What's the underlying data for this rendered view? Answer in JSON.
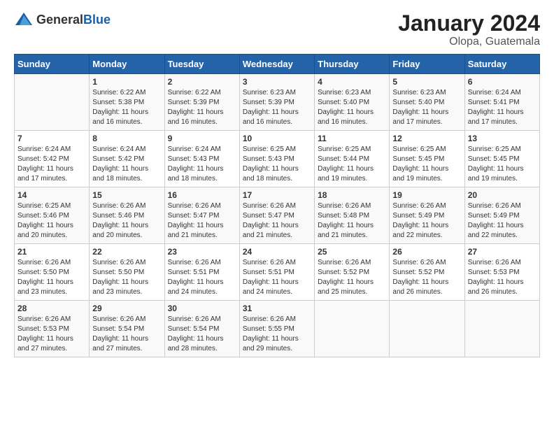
{
  "header": {
    "logo_general": "General",
    "logo_blue": "Blue",
    "title": "January 2024",
    "subtitle": "Olopa, Guatemala"
  },
  "days_of_week": [
    "Sunday",
    "Monday",
    "Tuesday",
    "Wednesday",
    "Thursday",
    "Friday",
    "Saturday"
  ],
  "weeks": [
    [
      {
        "day": "",
        "info": ""
      },
      {
        "day": "1",
        "info": "Sunrise: 6:22 AM\nSunset: 5:38 PM\nDaylight: 11 hours\nand 16 minutes."
      },
      {
        "day": "2",
        "info": "Sunrise: 6:22 AM\nSunset: 5:39 PM\nDaylight: 11 hours\nand 16 minutes."
      },
      {
        "day": "3",
        "info": "Sunrise: 6:23 AM\nSunset: 5:39 PM\nDaylight: 11 hours\nand 16 minutes."
      },
      {
        "day": "4",
        "info": "Sunrise: 6:23 AM\nSunset: 5:40 PM\nDaylight: 11 hours\nand 16 minutes."
      },
      {
        "day": "5",
        "info": "Sunrise: 6:23 AM\nSunset: 5:40 PM\nDaylight: 11 hours\nand 17 minutes."
      },
      {
        "day": "6",
        "info": "Sunrise: 6:24 AM\nSunset: 5:41 PM\nDaylight: 11 hours\nand 17 minutes."
      }
    ],
    [
      {
        "day": "7",
        "info": "Sunrise: 6:24 AM\nSunset: 5:42 PM\nDaylight: 11 hours\nand 17 minutes."
      },
      {
        "day": "8",
        "info": "Sunrise: 6:24 AM\nSunset: 5:42 PM\nDaylight: 11 hours\nand 18 minutes."
      },
      {
        "day": "9",
        "info": "Sunrise: 6:24 AM\nSunset: 5:43 PM\nDaylight: 11 hours\nand 18 minutes."
      },
      {
        "day": "10",
        "info": "Sunrise: 6:25 AM\nSunset: 5:43 PM\nDaylight: 11 hours\nand 18 minutes."
      },
      {
        "day": "11",
        "info": "Sunrise: 6:25 AM\nSunset: 5:44 PM\nDaylight: 11 hours\nand 19 minutes."
      },
      {
        "day": "12",
        "info": "Sunrise: 6:25 AM\nSunset: 5:45 PM\nDaylight: 11 hours\nand 19 minutes."
      },
      {
        "day": "13",
        "info": "Sunrise: 6:25 AM\nSunset: 5:45 PM\nDaylight: 11 hours\nand 19 minutes."
      }
    ],
    [
      {
        "day": "14",
        "info": "Sunrise: 6:25 AM\nSunset: 5:46 PM\nDaylight: 11 hours\nand 20 minutes."
      },
      {
        "day": "15",
        "info": "Sunrise: 6:26 AM\nSunset: 5:46 PM\nDaylight: 11 hours\nand 20 minutes."
      },
      {
        "day": "16",
        "info": "Sunrise: 6:26 AM\nSunset: 5:47 PM\nDaylight: 11 hours\nand 21 minutes."
      },
      {
        "day": "17",
        "info": "Sunrise: 6:26 AM\nSunset: 5:47 PM\nDaylight: 11 hours\nand 21 minutes."
      },
      {
        "day": "18",
        "info": "Sunrise: 6:26 AM\nSunset: 5:48 PM\nDaylight: 11 hours\nand 21 minutes."
      },
      {
        "day": "19",
        "info": "Sunrise: 6:26 AM\nSunset: 5:49 PM\nDaylight: 11 hours\nand 22 minutes."
      },
      {
        "day": "20",
        "info": "Sunrise: 6:26 AM\nSunset: 5:49 PM\nDaylight: 11 hours\nand 22 minutes."
      }
    ],
    [
      {
        "day": "21",
        "info": "Sunrise: 6:26 AM\nSunset: 5:50 PM\nDaylight: 11 hours\nand 23 minutes."
      },
      {
        "day": "22",
        "info": "Sunrise: 6:26 AM\nSunset: 5:50 PM\nDaylight: 11 hours\nand 23 minutes."
      },
      {
        "day": "23",
        "info": "Sunrise: 6:26 AM\nSunset: 5:51 PM\nDaylight: 11 hours\nand 24 minutes."
      },
      {
        "day": "24",
        "info": "Sunrise: 6:26 AM\nSunset: 5:51 PM\nDaylight: 11 hours\nand 24 minutes."
      },
      {
        "day": "25",
        "info": "Sunrise: 6:26 AM\nSunset: 5:52 PM\nDaylight: 11 hours\nand 25 minutes."
      },
      {
        "day": "26",
        "info": "Sunrise: 6:26 AM\nSunset: 5:52 PM\nDaylight: 11 hours\nand 26 minutes."
      },
      {
        "day": "27",
        "info": "Sunrise: 6:26 AM\nSunset: 5:53 PM\nDaylight: 11 hours\nand 26 minutes."
      }
    ],
    [
      {
        "day": "28",
        "info": "Sunrise: 6:26 AM\nSunset: 5:53 PM\nDaylight: 11 hours\nand 27 minutes."
      },
      {
        "day": "29",
        "info": "Sunrise: 6:26 AM\nSunset: 5:54 PM\nDaylight: 11 hours\nand 27 minutes."
      },
      {
        "day": "30",
        "info": "Sunrise: 6:26 AM\nSunset: 5:54 PM\nDaylight: 11 hours\nand 28 minutes."
      },
      {
        "day": "31",
        "info": "Sunrise: 6:26 AM\nSunset: 5:55 PM\nDaylight: 11 hours\nand 29 minutes."
      },
      {
        "day": "",
        "info": ""
      },
      {
        "day": "",
        "info": ""
      },
      {
        "day": "",
        "info": ""
      }
    ]
  ]
}
